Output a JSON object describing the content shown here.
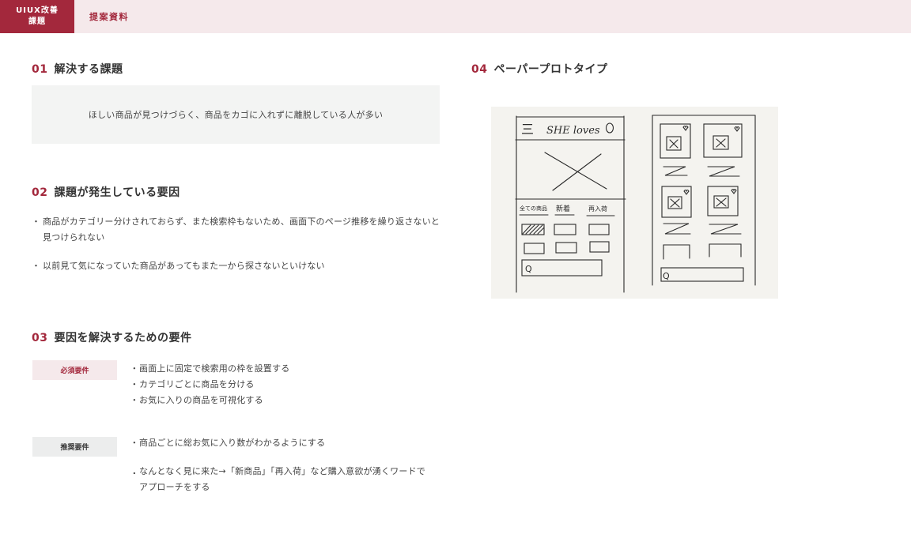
{
  "header": {
    "tag_line1": "UIUX改善",
    "tag_line2": "課題",
    "breadcrumb": "提案資料"
  },
  "section1": {
    "num": "01",
    "title": "解決する課題",
    "statement": "ほしい商品が見つけづらく、商品をカゴに入れずに離脱している人が多い"
  },
  "section2": {
    "num": "02",
    "title": "課題が発生している要因",
    "bullet_mark": "・",
    "items": [
      "商品がカテゴリー分けされておらず、また検索枠もないため、画面下のページ推移を繰り返さないと見つけられない",
      "以前見て気になっていた商品があってもまた一から探さないといけない"
    ]
  },
  "section3": {
    "num": "03",
    "title": "要因を解決するための要件",
    "bullet_mark": "・",
    "bullet_mark_alt": ".",
    "must_label": "必須要件",
    "must_items": [
      "画面上に固定で検索用の枠を設置する",
      "カテゴリごとに商品を分ける",
      "お気に入りの商品を可視化する"
    ],
    "rec_label": "推奨要件",
    "rec_items": [
      "商品ごとに総お気に入り数がわかるようにする",
      "なんとなく見に来た→「新商品」「再入荷」など購入意欲が湧くワードでアプローチをする"
    ]
  },
  "section4": {
    "num": "04",
    "title": "ペーパープロトタイプ",
    "sketch": {
      "menu_glyph": "三",
      "logo_text": "SHE loves",
      "cat_all": "全ての商品",
      "cat_new": "新着",
      "cat_restock": "再入荷",
      "search_glyph": "Q"
    }
  },
  "colors": {
    "accent": "#a3283c",
    "accent_light": "#f5e9eb",
    "box_gray": "#f3f4f3",
    "paper": "#f4f3ef"
  }
}
